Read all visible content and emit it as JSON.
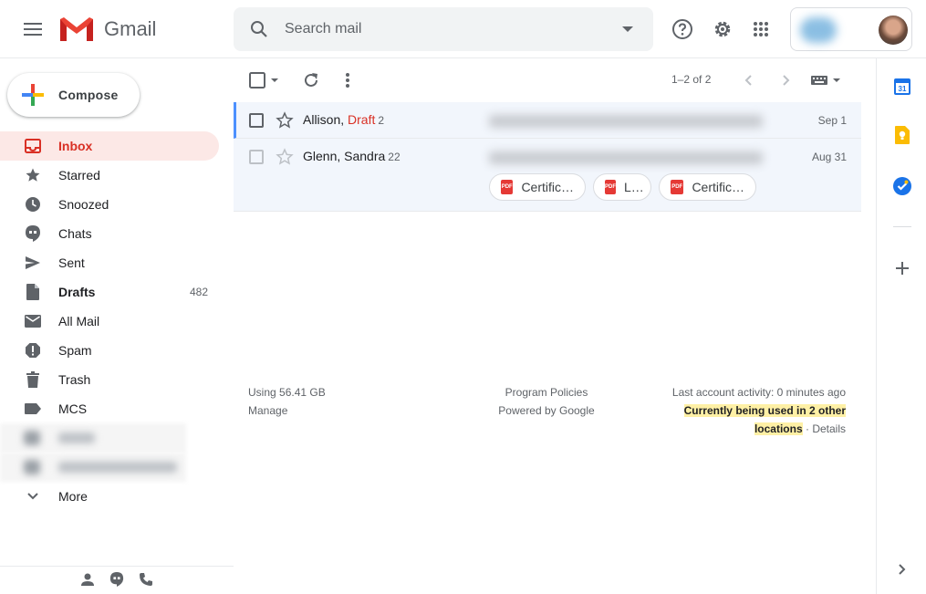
{
  "header": {
    "app_name": "Gmail",
    "search_placeholder": "Search mail"
  },
  "sidebar": {
    "compose_label": "Compose",
    "items": [
      {
        "label": "Inbox",
        "icon": "inbox-icon",
        "count": ""
      },
      {
        "label": "Starred",
        "icon": "star-icon",
        "count": ""
      },
      {
        "label": "Snoozed",
        "icon": "clock-icon",
        "count": ""
      },
      {
        "label": "Chats",
        "icon": "chat-icon",
        "count": ""
      },
      {
        "label": "Sent",
        "icon": "send-icon",
        "count": ""
      },
      {
        "label": "Drafts",
        "icon": "draft-icon",
        "count": "482"
      },
      {
        "label": "All Mail",
        "icon": "mail-icon",
        "count": ""
      },
      {
        "label": "Spam",
        "icon": "spam-icon",
        "count": ""
      },
      {
        "label": "Trash",
        "icon": "trash-icon",
        "count": ""
      },
      {
        "label": "MCS",
        "icon": "label-icon",
        "count": ""
      }
    ],
    "more_label": "More"
  },
  "toolbar": {
    "pager": "1–2 of 2"
  },
  "emails": [
    {
      "sender": "Allison, ",
      "draft": "Draft",
      "count": "2",
      "date": "Sep 1"
    },
    {
      "sender": "Glenn, Sandra",
      "draft": "",
      "count": "22",
      "date": "Aug 31",
      "attachments": [
        "Certific…",
        "L…",
        "Certific…"
      ]
    }
  ],
  "footer": {
    "storage": "Using 56.41 GB",
    "manage": "Manage",
    "policies": "Program Policies",
    "powered": "Powered by Google",
    "activity": "Last account activity: 0 minutes ago",
    "warning_line1": "Currently being used in 2 other",
    "warning_line2": "locations",
    "details": "Details"
  },
  "colors": {
    "accent_red": "#d93025",
    "active_bg": "#fce8e6",
    "selected_border": "#4d90fe",
    "highlight": "#fef0a5"
  }
}
